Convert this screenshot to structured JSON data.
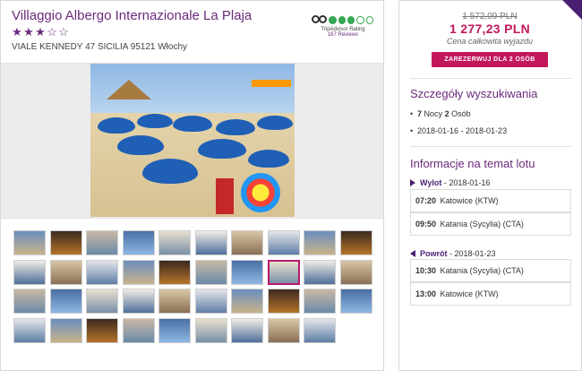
{
  "hotel": {
    "name": "Villaggio Albergo Internazionale La Plaja",
    "stars_filled": 3,
    "stars_total": 5,
    "address": "VIALE KENNEDY 47 SICILIA 95121 Włochy",
    "tripadvisor": {
      "label": "TripAdvisor Rating",
      "reviews": "167 Reviews",
      "bubbles_filled": 3,
      "bubbles_total": 5
    }
  },
  "gallery": {
    "main_photo_icon": "beach-photo",
    "thumbnail_count": 39,
    "selected_thumbnail": 17
  },
  "pricing": {
    "old_price": "1 572,09 PLN",
    "new_price": "1 277,23 PLN",
    "note": "Cena całkowita wyjazdu",
    "book_button": "ZAREZERWUJ DLA 2 OSÓB"
  },
  "search_details": {
    "title": "Szczegóły wyszukiwania",
    "nights_count": "7",
    "nights_label": "Nocy",
    "persons_count": "2",
    "persons_label": "Osób",
    "dates": "2018-01-16 - 2018-01-23"
  },
  "flight_info": {
    "title": "Informacje na temat lotu",
    "outbound": {
      "label": "Wylot",
      "date": "2018-01-16",
      "segments": [
        {
          "time": "07:20",
          "place": "Katowice (KTW)"
        },
        {
          "time": "09:50",
          "place": "Katania (Sycylia) (CTA)"
        }
      ]
    },
    "return": {
      "label": "Powrót",
      "date": "2018-01-23",
      "segments": [
        {
          "time": "10:30",
          "place": "Katania (Sycylia) (CTA)"
        },
        {
          "time": "13:00",
          "place": "Katowice (KTW)"
        }
      ]
    }
  },
  "colors": {
    "brand_purple": "#6b2a7c",
    "price_accent": "#c2185b",
    "tripadvisor_green": "#34a853"
  }
}
